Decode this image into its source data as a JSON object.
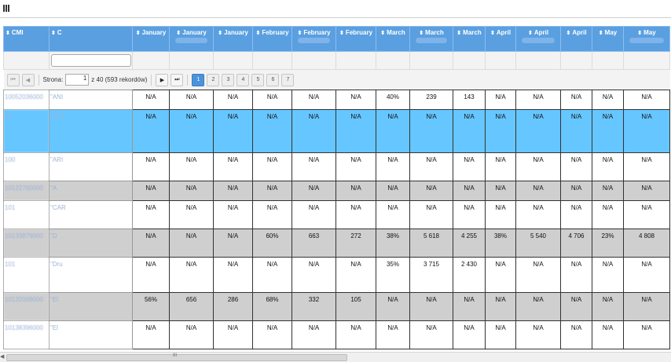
{
  "toolbar": {
    "menu_icon": "menu-bars-icon"
  },
  "columns": [
    {
      "label": "CMI",
      "sub": false
    },
    {
      "label": "C",
      "sub": false
    },
    {
      "label": "January",
      "sub": false
    },
    {
      "label": "January",
      "sub": true
    },
    {
      "label": "January",
      "sub": false
    },
    {
      "label": "February",
      "sub": false
    },
    {
      "label": "February",
      "sub": true
    },
    {
      "label": "February",
      "sub": false
    },
    {
      "label": "March",
      "sub": false
    },
    {
      "label": "March",
      "sub": true
    },
    {
      "label": "March",
      "sub": false
    },
    {
      "label": "April",
      "sub": false
    },
    {
      "label": "April",
      "sub": true
    },
    {
      "label": "April",
      "sub": false
    },
    {
      "label": "May",
      "sub": false
    },
    {
      "label": "May",
      "sub": true
    }
  ],
  "pager": {
    "label": "Strona:",
    "page": "1",
    "total": "z 40 (593 rekordów)",
    "pages": [
      "1",
      "2",
      "3",
      "4",
      "5",
      "6",
      "7"
    ],
    "active": "1"
  },
  "rows": [
    {
      "style": "white",
      "id": "10052036000",
      "name": "\"ANI",
      "vals": [
        "N/A",
        "N/A",
        "N/A",
        "N/A",
        "N/A",
        "N/A",
        "40%",
        "239",
        "143",
        "N/A",
        "N/A",
        "N/A",
        "N/A",
        "N/A"
      ]
    },
    {
      "style": "sel",
      "id": "10",
      "name": "\"ANT",
      "vals": [
        "N/A",
        "N/A",
        "N/A",
        "N/A",
        "N/A",
        "N/A",
        "N/A",
        "N/A",
        "N/A",
        "N/A",
        "N/A",
        "N/A",
        "N/A",
        "N/A"
      ]
    },
    {
      "style": "white",
      "id": "100",
      "name": "\"ARI",
      "vals": [
        "N/A",
        "N/A",
        "N/A",
        "N/A",
        "N/A",
        "N/A",
        "N/A",
        "N/A",
        "N/A",
        "N/A",
        "N/A",
        "N/A",
        "N/A",
        "N/A"
      ]
    },
    {
      "style": "gray",
      "id": "10122760000",
      "name": "\"A",
      "vals": [
        "N/A",
        "N/A",
        "N/A",
        "N/A",
        "N/A",
        "N/A",
        "N/A",
        "N/A",
        "N/A",
        "N/A",
        "N/A",
        "N/A",
        "N/A",
        "N/A"
      ]
    },
    {
      "style": "white",
      "id": "101",
      "name": "\"CAR",
      "vals": [
        "N/A",
        "N/A",
        "N/A",
        "N/A",
        "N/A",
        "N/A",
        "N/A",
        "N/A",
        "N/A",
        "N/A",
        "N/A",
        "N/A",
        "N/A",
        "N/A"
      ]
    },
    {
      "style": "gray",
      "id": "10133879000",
      "name": "\"D",
      "vals": [
        "N/A",
        "N/A",
        "N/A",
        "60%",
        "663",
        "272",
        "38%",
        "5 618",
        "4 255",
        "38%",
        "5 540",
        "4 706",
        "23%",
        "4 808"
      ]
    },
    {
      "style": "white",
      "id": "101",
      "name": "\"Dru",
      "vals": [
        "N/A",
        "N/A",
        "N/A",
        "N/A",
        "N/A",
        "N/A",
        "35%",
        "3 715",
        "2 430",
        "N/A",
        "N/A",
        "N/A",
        "N/A",
        "N/A"
      ]
    },
    {
      "style": "gray",
      "id": "10132009000",
      "name": "\"El",
      "vals": [
        "56%",
        "656",
        "286",
        "68%",
        "332",
        "105",
        "N/A",
        "N/A",
        "N/A",
        "N/A",
        "N/A",
        "N/A",
        "N/A",
        "N/A"
      ]
    },
    {
      "style": "white",
      "id": "10138396000",
      "name": "\"El",
      "vals": [
        "N/A",
        "N/A",
        "N/A",
        "N/A",
        "N/A",
        "N/A",
        "N/A",
        "N/A",
        "N/A",
        "N/A",
        "N/A",
        "N/A",
        "N/A",
        "N/A"
      ]
    }
  ]
}
